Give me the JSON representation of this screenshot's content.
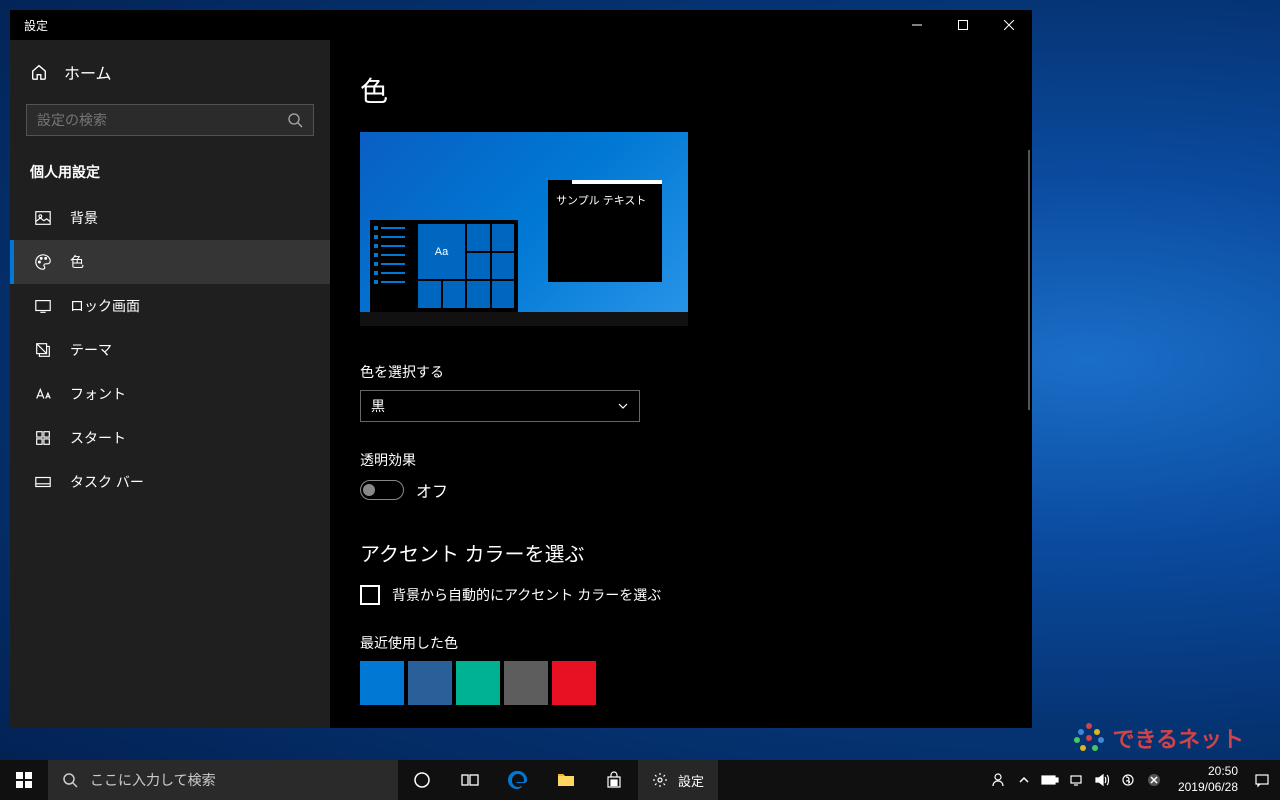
{
  "window": {
    "title": "設定"
  },
  "sidebar": {
    "home": "ホーム",
    "search_placeholder": "設定の検索",
    "section": "個人用設定",
    "items": [
      {
        "label": "背景"
      },
      {
        "label": "色"
      },
      {
        "label": "ロック画面"
      },
      {
        "label": "テーマ"
      },
      {
        "label": "フォント"
      },
      {
        "label": "スタート"
      },
      {
        "label": "タスク バー"
      }
    ]
  },
  "content": {
    "heading": "色",
    "preview_sample": "サンプル テキスト",
    "preview_aa": "Aa",
    "choose_color_label": "色を選択する",
    "choose_color_value": "黒",
    "transparency_label": "透明効果",
    "transparency_state": "オフ",
    "accent_heading": "アクセント カラーを選ぶ",
    "auto_accent_label": "背景から自動的にアクセント カラーを選ぶ",
    "recent_colors_label": "最近使用した色",
    "recent_colors": [
      "#0078d4",
      "#2a6099",
      "#00b294",
      "#5d5d5d",
      "#e81123"
    ]
  },
  "taskbar": {
    "search_placeholder": "ここに入力して検索",
    "active_app": "設定",
    "time": "20:50",
    "date": "2019/06/28"
  },
  "watermark": "できるネット"
}
